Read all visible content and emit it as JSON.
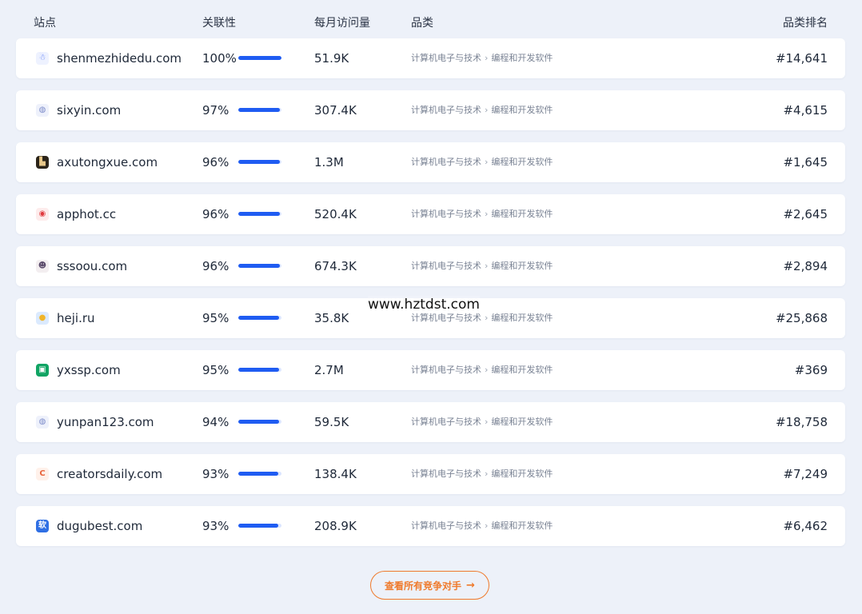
{
  "header": {
    "site": "站点",
    "relevance": "关联性",
    "monthly_visits": "每月访问量",
    "category": "品类",
    "category_rank": "品类排名"
  },
  "rows": [
    {
      "domain": "shenmezhidedu.com",
      "relevance": "100%",
      "relevance_value": 100,
      "visits": "51.9K",
      "category_main": "计算机电子与技术",
      "category_sub": "编程和开发软件",
      "rank": "#14,641",
      "icon": "robot-favicon-icon",
      "icon_bg": "#eef2ff",
      "icon_fg": "#5b7cf7",
      "icon_glyph": "☃"
    },
    {
      "domain": "sixyin.com",
      "relevance": "97%",
      "relevance_value": 97,
      "visits": "307.4K",
      "category_main": "计算机电子与技术",
      "category_sub": "编程和开发软件",
      "rank": "#4,615",
      "icon": "globe-favicon-icon",
      "icon_bg": "#eef1fb",
      "icon_fg": "#7c8bc9",
      "icon_glyph": "◍"
    },
    {
      "domain": "axutongxue.com",
      "relevance": "96%",
      "relevance_value": 96,
      "visits": "1.3M",
      "category_main": "计算机电子与技术",
      "category_sub": "编程和开发软件",
      "rank": "#1,645",
      "icon": "dark-photo-favicon-icon",
      "icon_bg": "#2b2419",
      "icon_fg": "#e8c88a",
      "icon_glyph": "▙"
    },
    {
      "domain": "apphot.cc",
      "relevance": "96%",
      "relevance_value": 96,
      "visits": "520.4K",
      "category_main": "计算机电子与技术",
      "category_sub": "编程和开发软件",
      "rank": "#2,645",
      "icon": "red-logo-favicon-icon",
      "icon_bg": "#fdecec",
      "icon_fg": "#e0393e",
      "icon_glyph": "◉"
    },
    {
      "domain": "sssoou.com",
      "relevance": "96%",
      "relevance_value": 96,
      "visits": "674.3K",
      "category_main": "计算机电子与技术",
      "category_sub": "编程和开发软件",
      "rank": "#2,894",
      "icon": "face-favicon-icon",
      "icon_bg": "#f3eef0",
      "icon_fg": "#5a4a6a",
      "icon_glyph": "☻"
    },
    {
      "domain": "heji.ru",
      "relevance": "95%",
      "relevance_value": 95,
      "visits": "35.8K",
      "category_main": "计算机电子与技术",
      "category_sub": "编程和开发软件",
      "rank": "#25,868",
      "icon": "circle-favicon-icon",
      "icon_bg": "#dbeafe",
      "icon_fg": "#f0b429",
      "icon_glyph": "●"
    },
    {
      "domain": "yxssp.com",
      "relevance": "95%",
      "relevance_value": 95,
      "visits": "2.7M",
      "category_main": "计算机电子与技术",
      "category_sub": "编程和开发软件",
      "rank": "#369",
      "icon": "green-square-favicon-icon",
      "icon_bg": "#10a463",
      "icon_fg": "#ffffff",
      "icon_glyph": "▣"
    },
    {
      "domain": "yunpan123.com",
      "relevance": "94%",
      "relevance_value": 94,
      "visits": "59.5K",
      "category_main": "计算机电子与技术",
      "category_sub": "编程和开发软件",
      "rank": "#18,758",
      "icon": "globe-favicon-icon",
      "icon_bg": "#eef1fb",
      "icon_fg": "#7c8bc9",
      "icon_glyph": "◍"
    },
    {
      "domain": "creatorsdaily.com",
      "relevance": "93%",
      "relevance_value": 93,
      "visits": "138.4K",
      "category_main": "计算机电子与技术",
      "category_sub": "编程和开发软件",
      "rank": "#7,249",
      "icon": "c-letter-favicon-icon",
      "icon_bg": "#fff1ea",
      "icon_fg": "#e8643c",
      "icon_glyph": "C"
    },
    {
      "domain": "dugubest.com",
      "relevance": "93%",
      "relevance_value": 93,
      "visits": "208.9K",
      "category_main": "计算机电子与技术",
      "category_sub": "编程和开发软件",
      "rank": "#6,462",
      "icon": "blue-square-favicon-icon",
      "icon_bg": "#2f6fe4",
      "icon_fg": "#ffffff",
      "icon_glyph": "软"
    }
  ],
  "watermark": "www.hztdst.com",
  "more_button": {
    "label": "查看所有竞争对手",
    "icon": "arrow-right-icon",
    "color": "#ef7a2c"
  },
  "colors": {
    "background": "#edf1f9",
    "bar_fill": "#1f5cf2",
    "bar_track": "#dce6ff"
  }
}
